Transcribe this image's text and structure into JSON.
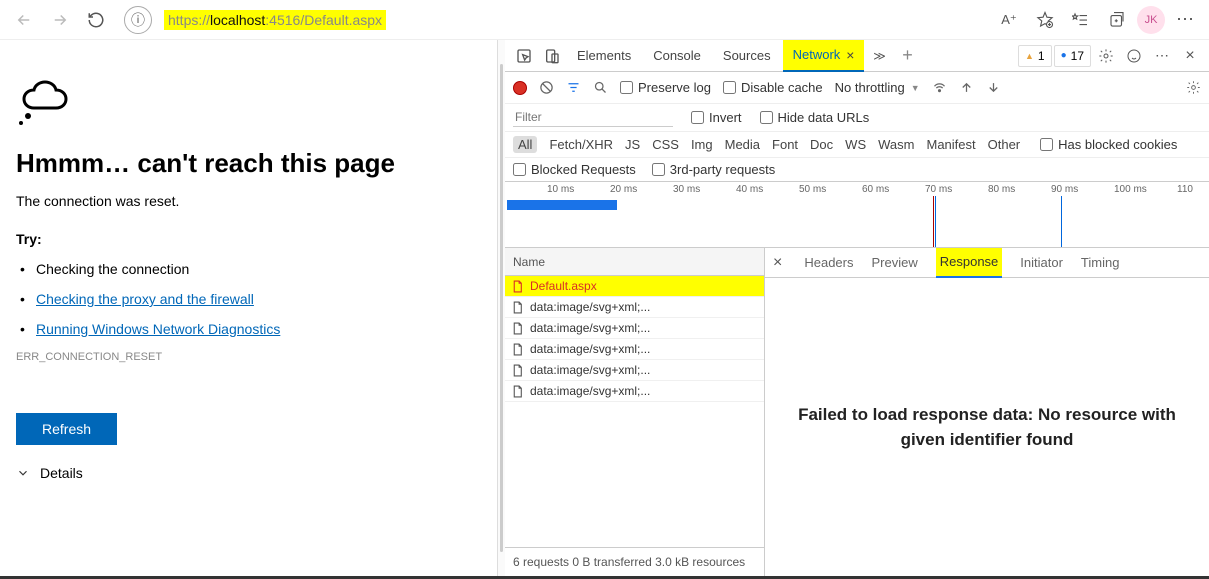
{
  "toolbar": {
    "url": {
      "protocol": "https://",
      "host": "localhost",
      "port": ":4516",
      "path": "/Default.aspx"
    },
    "reader": "A⁺",
    "avatar": "JK"
  },
  "page": {
    "title": "Hmmm… can't reach this page",
    "subtitle": "The connection was reset.",
    "try": "Try:",
    "items": [
      {
        "text": "Checking the connection",
        "link": false
      },
      {
        "text": "Checking the proxy and the firewall",
        "link": true
      },
      {
        "text": "Running Windows Network Diagnostics",
        "link": true
      }
    ],
    "errcode": "ERR_CONNECTION_RESET",
    "refresh": "Refresh",
    "details": "Details"
  },
  "devtools": {
    "tabs": {
      "elements": "Elements",
      "console": "Console",
      "sources": "Sources",
      "network": "Network"
    },
    "warn_count": "1",
    "info_count": "17",
    "toolbar": {
      "preserve": "Preserve log",
      "disablecache": "Disable cache",
      "throttling": "No throttling"
    },
    "filter": {
      "placeholder": "Filter",
      "invert": "Invert",
      "hidedata": "Hide data URLs"
    },
    "types": [
      "All",
      "Fetch/XHR",
      "JS",
      "CSS",
      "Img",
      "Media",
      "Font",
      "Doc",
      "WS",
      "Wasm",
      "Manifest",
      "Other"
    ],
    "hasblocked": "Has blocked cookies",
    "blockedreq": "Blocked Requests",
    "thirdparty": "3rd-party requests",
    "timeline_ticks": [
      "10 ms",
      "20 ms",
      "30 ms",
      "40 ms",
      "50 ms",
      "60 ms",
      "70 ms",
      "80 ms",
      "90 ms",
      "100 ms",
      "110"
    ],
    "name_header": "Name",
    "requests": [
      {
        "name": "Default.aspx",
        "error": true
      },
      {
        "name": "data:image/svg+xml;...",
        "error": false
      },
      {
        "name": "data:image/svg+xml;...",
        "error": false
      },
      {
        "name": "data:image/svg+xml;...",
        "error": false
      },
      {
        "name": "data:image/svg+xml;...",
        "error": false
      },
      {
        "name": "data:image/svg+xml;...",
        "error": false
      }
    ],
    "status": "6 requests   0 B transferred   3.0 kB resources",
    "detail_tabs": {
      "headers": "Headers",
      "preview": "Preview",
      "response": "Response",
      "initiator": "Initiator",
      "timing": "Timing"
    },
    "detail_msg": "Failed to load response data: No resource with given identifier found"
  }
}
